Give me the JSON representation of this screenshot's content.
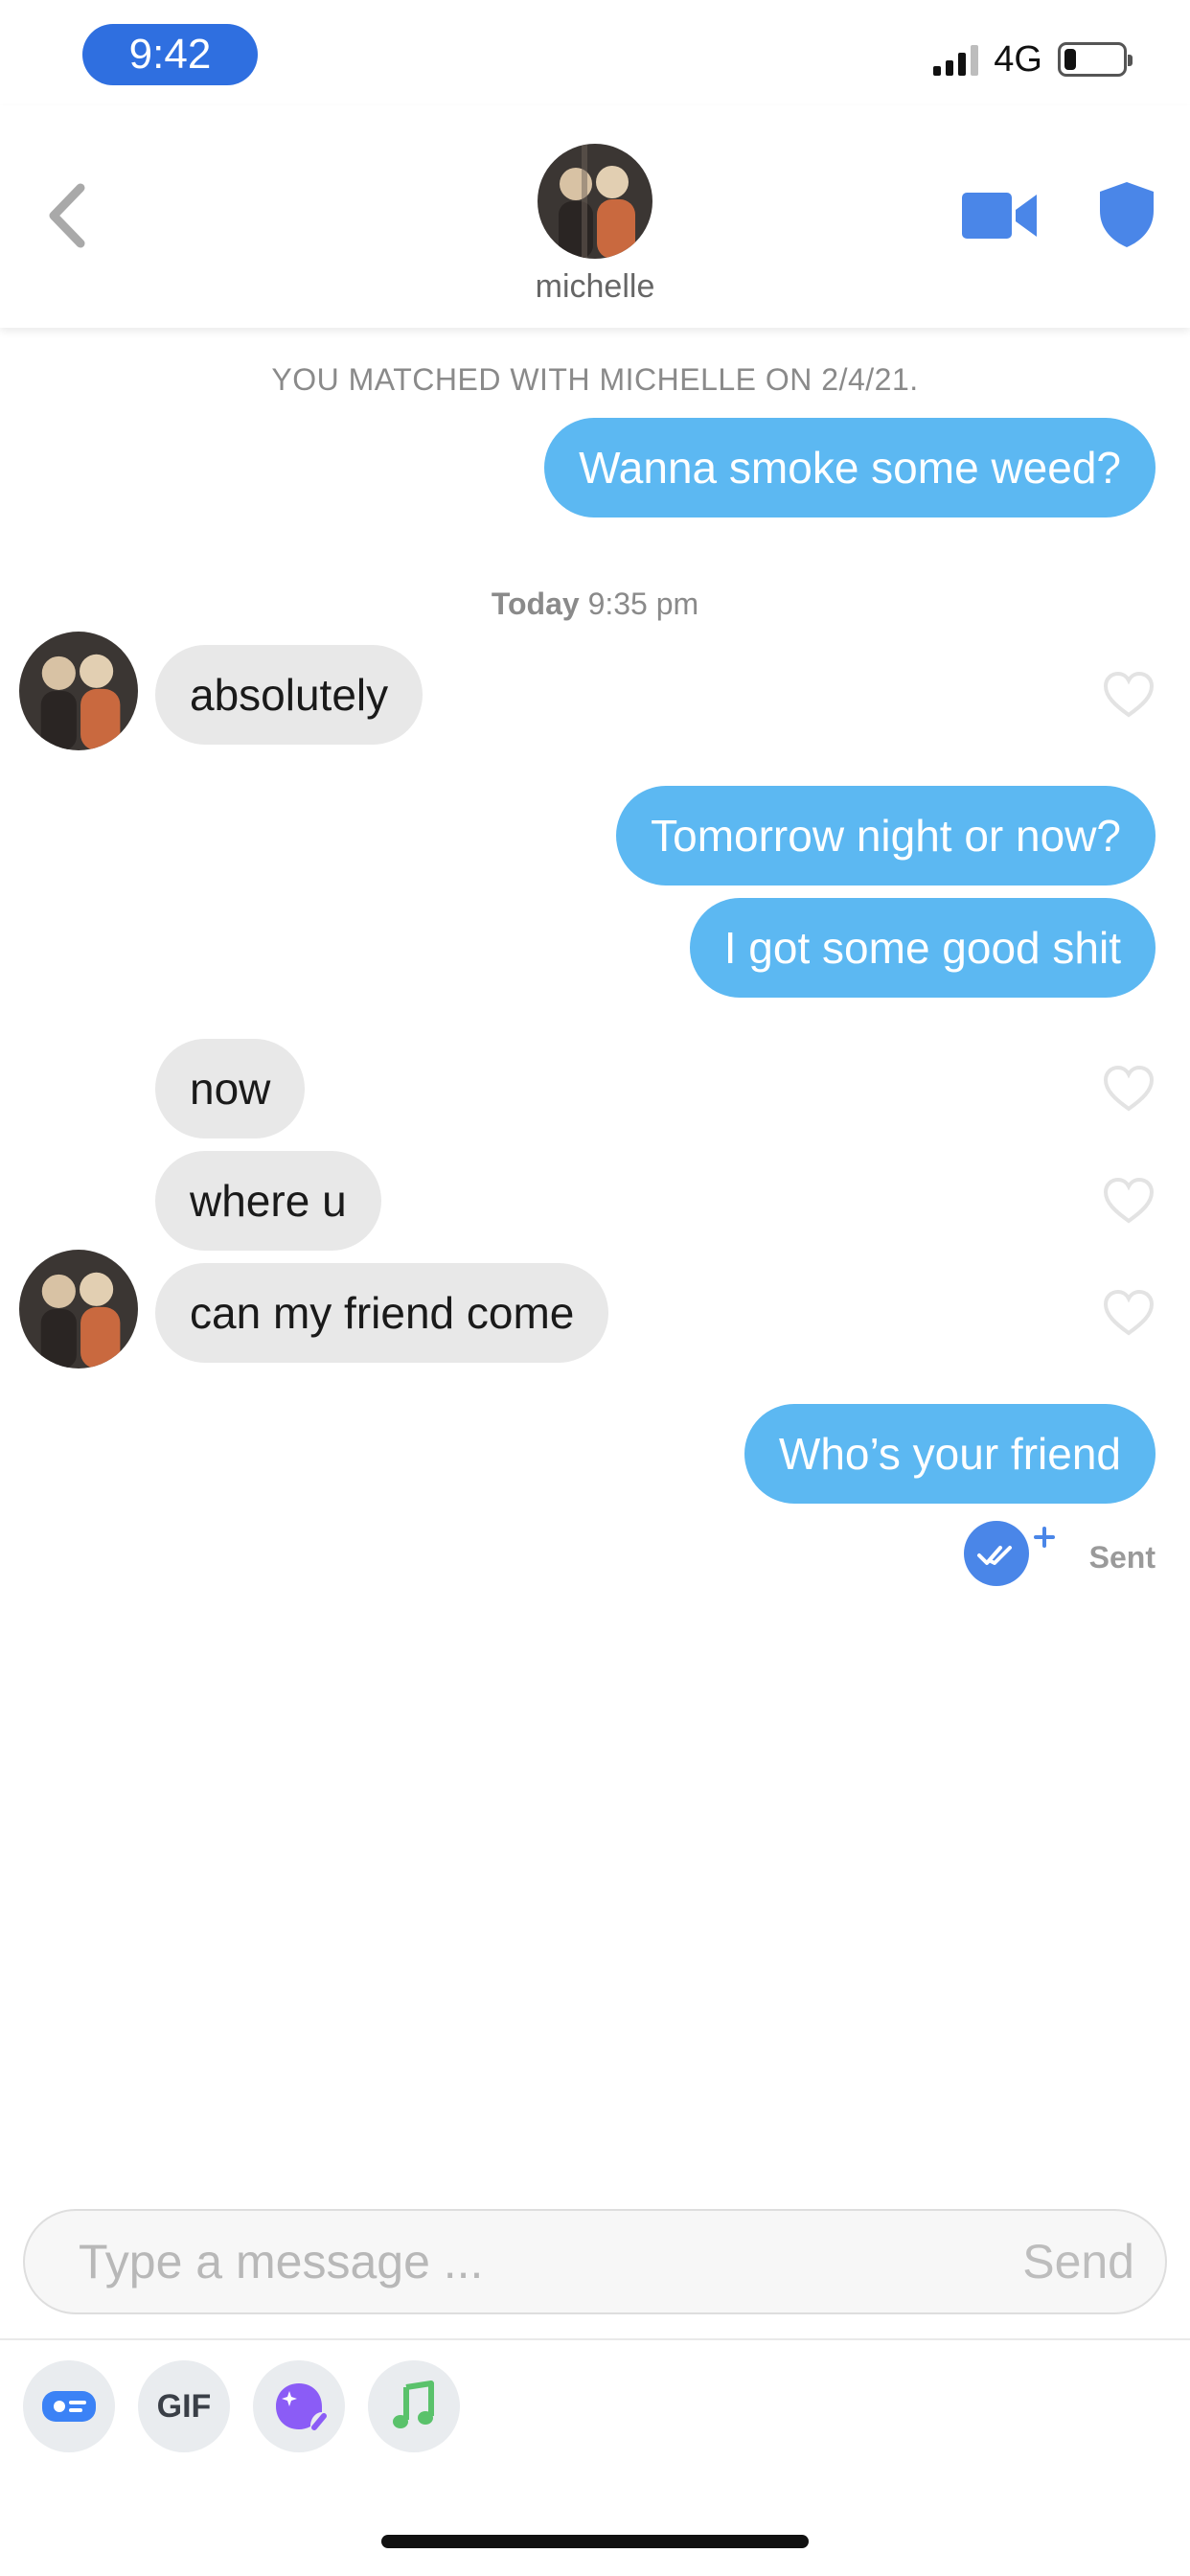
{
  "status_bar": {
    "time": "9:42",
    "network": "4G",
    "battery_level": 0.2
  },
  "header": {
    "name": "michelle",
    "back_icon": "chevron-left-icon",
    "video_icon": "video-camera-icon",
    "safety_icon": "shield-icon",
    "accent_color": "#4a86e8"
  },
  "chat": {
    "matched_text": "YOU MATCHED WITH MICHELLE ON 2/4/21.",
    "day_separator": {
      "day": "Today",
      "time": "9:35 pm"
    },
    "messages": [
      {
        "from": "me",
        "text": "Wanna smoke some weed?"
      },
      {
        "from": "them",
        "text": "absolutely"
      },
      {
        "from": "me",
        "text": "Tomorrow night or now?"
      },
      {
        "from": "me",
        "text": "I got some good shit"
      },
      {
        "from": "them",
        "text": "now"
      },
      {
        "from": "them",
        "text": "where u"
      },
      {
        "from": "them",
        "text": "can my friend come"
      },
      {
        "from": "me",
        "text": "Who’s your friend"
      }
    ],
    "status": "Sent",
    "outgoing_color": "#5cb8f2",
    "incoming_color": "#e8e8e8"
  },
  "composer": {
    "placeholder": "Type a message ...",
    "value": "",
    "send_label": "Send",
    "tools": [
      {
        "icon": "contact-card-icon"
      },
      {
        "label": "GIF"
      },
      {
        "icon": "sparkle-sticker-icon"
      },
      {
        "icon": "music-note-icon"
      }
    ]
  }
}
